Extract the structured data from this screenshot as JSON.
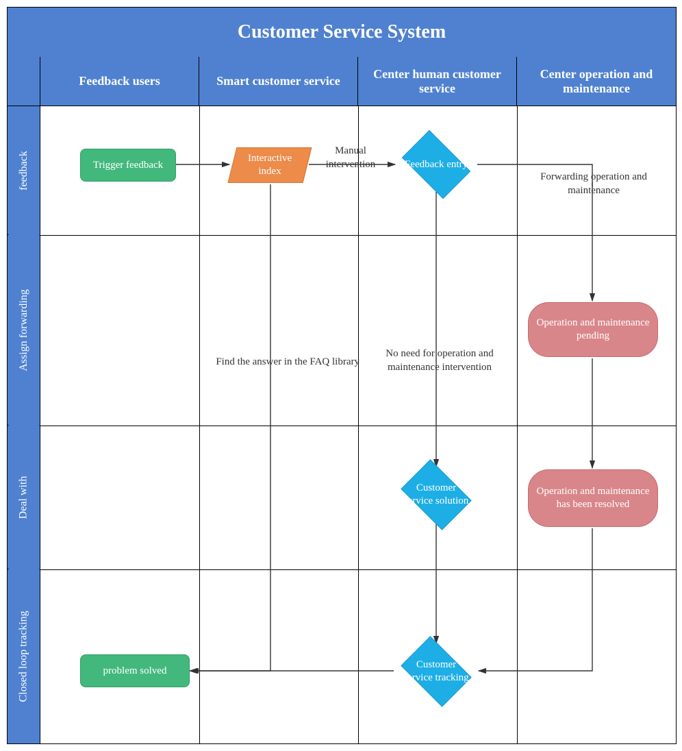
{
  "title": "Customer Service System",
  "columns": [
    "Feedback users",
    "Smart customer service",
    "Center human customer service",
    "Center operation and maintenance"
  ],
  "rows": [
    "feedback",
    "Assign forwarding",
    "Deal with",
    "Closed loop tracking"
  ],
  "nodes": {
    "trigger_feedback": "Trigger feedback",
    "interactive_index": "Interactive index",
    "feedback_entry": "Feedback entry",
    "om_pending": "Operation and maintenance pending",
    "cs_solution": "Customer service solution",
    "om_resolved": "Operation and maintenance has been resolved",
    "cs_tracking": "Customer service tracking",
    "problem_solved": "problem solved"
  },
  "edges": {
    "manual_intervention": "Manual intervention",
    "forwarding_om": "Forwarding operation and maintenance",
    "find_faq": "Find the answer in the FAQ library",
    "no_need_om": "No need for operation and maintenance intervention"
  }
}
